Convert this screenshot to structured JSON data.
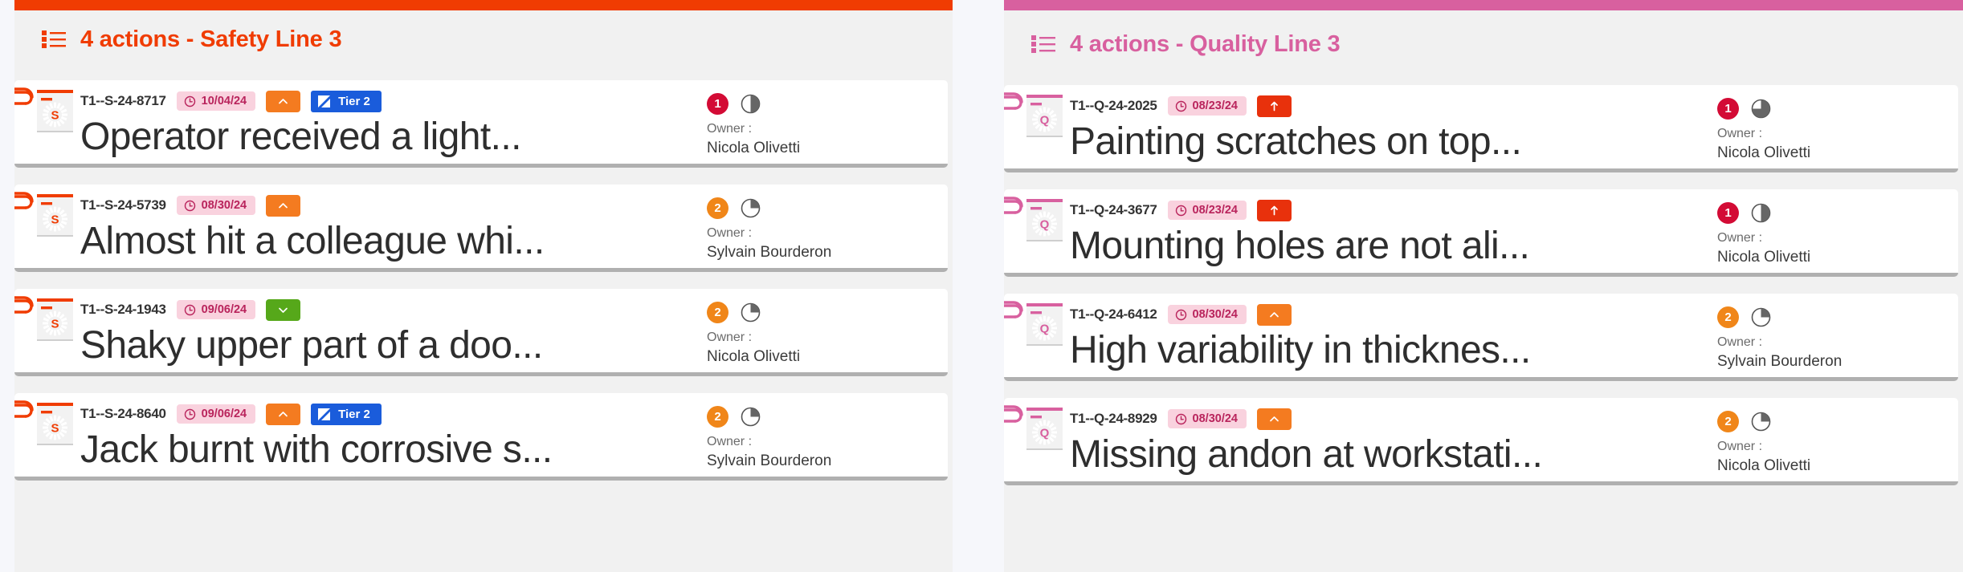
{
  "background_color": "#f6f7fb",
  "panels": [
    {
      "key": "safety",
      "accent_color": "#f03c02",
      "title": "4 actions - Safety Line 3",
      "list_icon": "list-icon",
      "cards": [
        {
          "clip_icon": "paperclip-icon",
          "type_letter": "S",
          "ref_id": "T1--S-24-8717",
          "date": "10/04/24",
          "date_icon": "clock-icon",
          "priority": {
            "icon": "chevron-up-icon",
            "color": "#f47b20"
          },
          "tier": {
            "label": "Tier 2",
            "color": "#1a5cdb"
          },
          "title": "Operator received a light...",
          "count": "1",
          "count_color": "#d30b35",
          "progress": 50,
          "owner_label": "Owner :",
          "owner_name": "Nicola Olivetti"
        },
        {
          "clip_icon": "paperclip-icon",
          "type_letter": "S",
          "ref_id": "T1--S-24-5739",
          "date": "08/30/24",
          "date_icon": "clock-icon",
          "priority": {
            "icon": "chevron-up-icon",
            "color": "#f47b20"
          },
          "tier": null,
          "title": "Almost hit a colleague whi...",
          "count": "2",
          "count_color": "#f08619",
          "progress": 25,
          "owner_label": "Owner :",
          "owner_name": "Sylvain Bourderon"
        },
        {
          "clip_icon": "paperclip-icon",
          "type_letter": "S",
          "ref_id": "T1--S-24-1943",
          "date": "09/06/24",
          "date_icon": "clock-icon",
          "priority": {
            "icon": "chevron-down-icon",
            "color": "#56a81a"
          },
          "tier": null,
          "title": "Shaky upper part of a doo...",
          "count": "2",
          "count_color": "#f08619",
          "progress": 25,
          "owner_label": "Owner :",
          "owner_name": "Nicola Olivetti"
        },
        {
          "clip_icon": "paperclip-icon",
          "type_letter": "S",
          "ref_id": "T1--S-24-8640",
          "date": "09/06/24",
          "date_icon": "clock-icon",
          "priority": {
            "icon": "chevron-up-icon",
            "color": "#f47b20"
          },
          "tier": {
            "label": "Tier 2",
            "color": "#1a5cdb"
          },
          "title": "Jack burnt with corrosive s...",
          "count": "2",
          "count_color": "#f08619",
          "progress": 25,
          "owner_label": "Owner :",
          "owner_name": "Sylvain Bourderon"
        }
      ]
    },
    {
      "key": "quality",
      "accent_color": "#d8609f",
      "title": "4 actions - Quality Line 3",
      "list_icon": "list-icon",
      "cards": [
        {
          "clip_icon": "paperclip-icon",
          "type_letter": "Q",
          "ref_id": "T1--Q-24-2025",
          "date": "08/23/24",
          "date_icon": "clock-icon",
          "priority": {
            "icon": "arrow-up-icon",
            "color": "#e8310c"
          },
          "tier": null,
          "title": "Painting scratches on top...",
          "count": "1",
          "count_color": "#d30b35",
          "progress": 75,
          "owner_label": "Owner :",
          "owner_name": "Nicola Olivetti"
        },
        {
          "clip_icon": "paperclip-icon",
          "type_letter": "Q",
          "ref_id": "T1--Q-24-3677",
          "date": "08/23/24",
          "date_icon": "clock-icon",
          "priority": {
            "icon": "arrow-up-icon",
            "color": "#e8310c"
          },
          "tier": null,
          "title": "Mounting holes are not ali...",
          "count": "1",
          "count_color": "#d30b35",
          "progress": 50,
          "owner_label": "Owner :",
          "owner_name": "Nicola Olivetti"
        },
        {
          "clip_icon": "paperclip-icon",
          "type_letter": "Q",
          "ref_id": "T1--Q-24-6412",
          "date": "08/30/24",
          "date_icon": "clock-icon",
          "priority": {
            "icon": "chevron-up-icon",
            "color": "#f47b20"
          },
          "tier": null,
          "title": "High variability in thicknes...",
          "count": "2",
          "count_color": "#f08619",
          "progress": 25,
          "owner_label": "Owner :",
          "owner_name": "Sylvain Bourderon"
        },
        {
          "clip_icon": "paperclip-icon",
          "type_letter": "Q",
          "ref_id": "T1--Q-24-8929",
          "date": "08/30/24",
          "date_icon": "clock-icon",
          "priority": {
            "icon": "chevron-up-icon",
            "color": "#f47b20"
          },
          "tier": null,
          "title": "Missing andon at workstati...",
          "count": "2",
          "count_color": "#f08619",
          "progress": 25,
          "owner_label": "Owner :",
          "owner_name": "Nicola Olivetti"
        }
      ]
    }
  ]
}
